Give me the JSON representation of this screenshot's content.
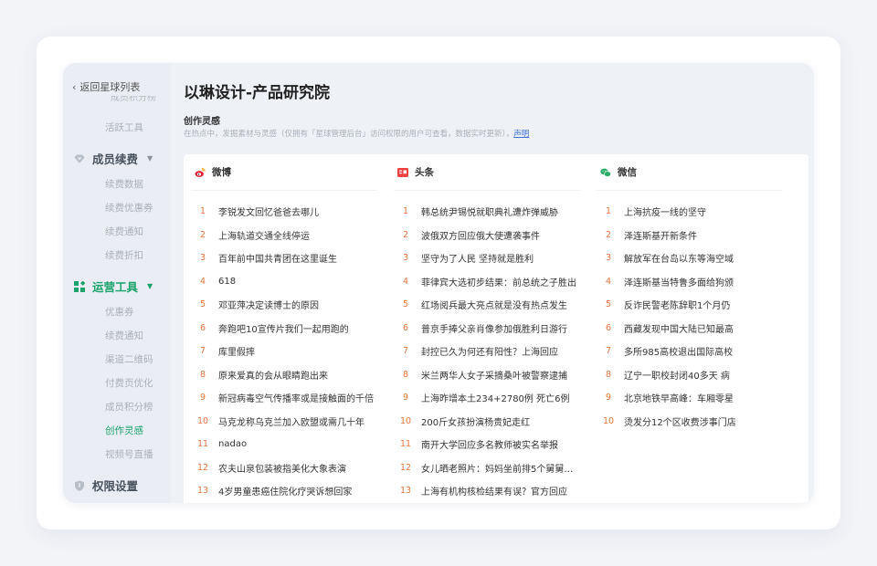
{
  "sidebar": {
    "back_label": "返回星球列表",
    "cut_item": "成员积分榜",
    "items_top": [
      {
        "label": "活跃工具"
      }
    ],
    "group_renewal": {
      "label": "成员续费",
      "items": [
        "续费数据",
        "续费优惠券",
        "续费通知",
        "续费折扣"
      ]
    },
    "group_ops": {
      "label": "运营工具",
      "items": [
        "优惠券",
        "续费通知",
        "渠道二维码",
        "付费页优化",
        "成员积分榜",
        "创作灵感",
        "视频号直播"
      ],
      "active_item": "创作灵感"
    },
    "group_perm": {
      "label": "权限设置"
    }
  },
  "page": {
    "title": "以琳设计-产品研究院",
    "section_title": "创作灵感",
    "section_desc": "在热点中，发掘素材与灵感（仅拥有「星球管理后台」访问权限的用户可查看，数据实时更新），",
    "section_desc_link": "声明"
  },
  "columns": [
    {
      "name": "微博",
      "icon": "weibo-icon",
      "color": "#e6162d",
      "items": [
        "李锐发文回忆爸爸去哪儿",
        "上海轨道交通全线停运",
        "百年前中国共青团在这里诞生",
        "618",
        "邓亚萍决定读博士的原因",
        "奔跑吧10宣传片我们一起用跑的",
        "库里假摔",
        "原来爱真的会从眼睛跑出来",
        "新冠病毒空气传播率或是接触面的千倍",
        "马克龙称乌克兰加入欧盟或需几十年",
        "nadao",
        "农夫山泉包装被指美化大象表演",
        "4岁男童患癌住院化疗哭诉想回家"
      ]
    },
    {
      "name": "头条",
      "icon": "toutiao-icon",
      "color": "#f04142",
      "items": [
        "韩总统尹锡悦就职典礼遭炸弹威胁",
        "波俄双方回应俄大使遭袭事件",
        "坚守为了人民 坚持就是胜利",
        "菲律宾大选初步结果：前总统之子胜出",
        "红场阅兵最大亮点就是没有热点发生",
        "普京手捧父亲肖像参加俄胜利日游行",
        "封控已久为何还有阳性？上海回应",
        "米兰两华人女子采摘桑叶被警察逮捕",
        "上海昨增本土234+2780例 死亡6例",
        "200斤女孩扮演杨贵妃走红",
        "南开大学回应多名教师被实名举报",
        "女儿晒老照片：妈妈坐前排5个舅舅…",
        "上海有机构核检结果有误？官方回应"
      ]
    },
    {
      "name": "微信",
      "icon": "wechat-icon",
      "color": "#2aae67",
      "items": [
        "上海抗疫一线的坚守",
        "泽连斯基开新条件",
        "解放军在台岛以东等海空域",
        "泽连斯基当特鲁多面给狗颁",
        "反诈民警老陈辞职1个月仍",
        "西藏发现中国大陆已知最高",
        "多所985高校退出国际高校",
        "辽宁一职校封闭40多天 病",
        "北京地铁早高峰：车厢零星",
        "烫发分12个区收费涉事门店"
      ]
    }
  ],
  "colors": {
    "accent_green": "#1aa36a",
    "rank_number": "#e8743b"
  }
}
